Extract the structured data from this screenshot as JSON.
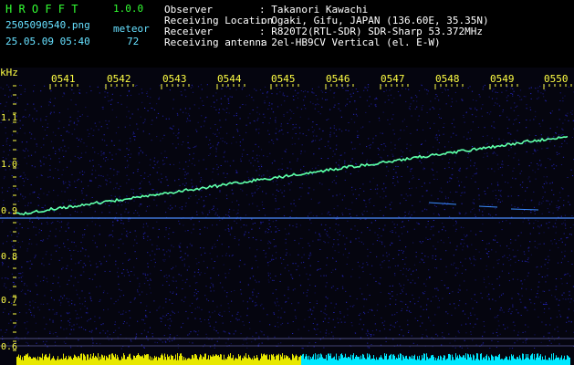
{
  "app": {
    "title": "H R O F F T",
    "version": "1.0.0"
  },
  "file": {
    "name": "2505090540.png",
    "datetime": "25.05.09 05:40"
  },
  "meteor": {
    "label": "meteor",
    "count": "72"
  },
  "info": [
    {
      "label": "Observer",
      "value": ": Takanori Kawachi"
    },
    {
      "label": "Receiving Location",
      "value": ": Ogaki, Gifu, JAPAN (136.60E, 35.35N)"
    },
    {
      "label": "Receiver",
      "value": ": R820T2(RTL-SDR) SDR-Sharp 53.372MHz"
    },
    {
      "label": "Receiving antenna",
      "value": ": 2el-HB9CV Vertical (el. E-W)"
    }
  ],
  "axis": {
    "unit": "kHz",
    "x_ticks": [
      "0541",
      "0542",
      "0543",
      "0544",
      "0545",
      "0546",
      "0547",
      "0548",
      "0549",
      "0550"
    ],
    "y_ticks": [
      "1.1",
      "1.0",
      "0.9",
      "0.8",
      "0.7",
      "0.6"
    ]
  },
  "colors": {
    "background": "#000000",
    "noise": "#1a1a8c",
    "signal": "#40ff80",
    "header_text": "#ffffff",
    "tick_text": "#ffff44",
    "title_text": "#33ff33"
  }
}
